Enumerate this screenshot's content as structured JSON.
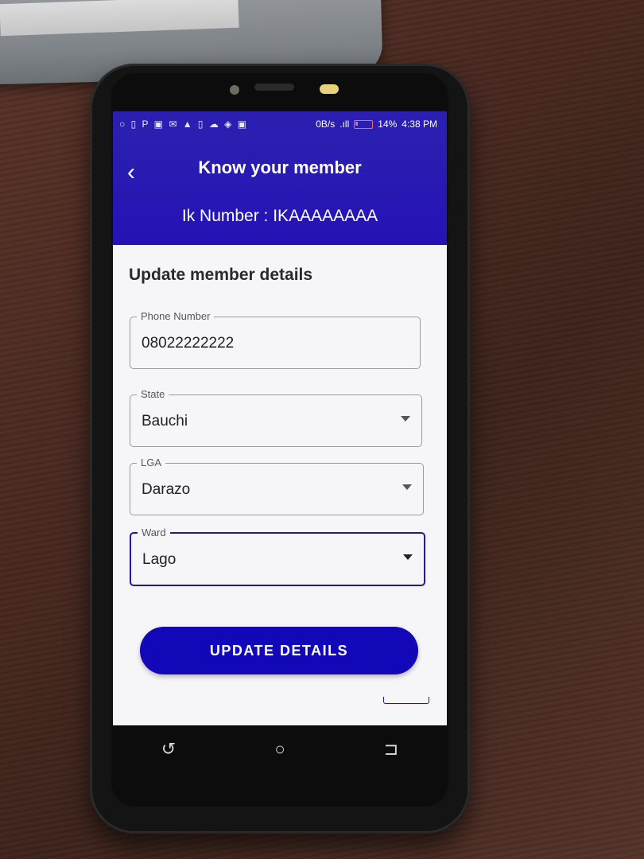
{
  "status_bar": {
    "left_icons": "○ ▯ P ▣ ✉ ▲ ▯ ☁ ◈ ▣",
    "data_rate": "0B/s",
    "battery_percent": "14%",
    "time": "4:38 PM"
  },
  "app_bar": {
    "title": "Know your member",
    "ik_number_line": "Ik Number : IKAAAAAAAA",
    "back_icon": "chevron-left-icon"
  },
  "form": {
    "section_title": "Update member details",
    "phone": {
      "label": "Phone Number",
      "value": "08022222222"
    },
    "state": {
      "label": "State",
      "value": "Bauchi"
    },
    "lga": {
      "label": "LGA",
      "value": "Darazo"
    },
    "ward": {
      "label": "Ward",
      "value": "Lago"
    },
    "submit_label": "UPDATE DETAILS"
  },
  "nav": {
    "recents_glyph": "↺",
    "home_glyph": "○",
    "back_glyph": "⊐"
  },
  "colors": {
    "primary": "#2512b5",
    "button": "#1208b8",
    "background": "#f6f6f8"
  }
}
